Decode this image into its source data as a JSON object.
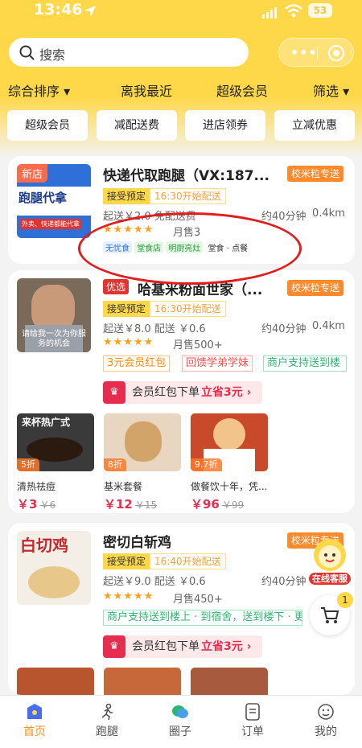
{
  "status_bar": {
    "time": "13:46",
    "battery": "53"
  },
  "search": {
    "placeholder": "搜索"
  },
  "sort_bar": {
    "items": [
      "综合排序 ▾",
      "离我最近",
      "超级会员",
      "筛选 ▾"
    ]
  },
  "filter_chips": [
    "超级会员",
    "减配送费",
    "进店领券",
    "立减优惠"
  ],
  "shops": [
    {
      "badge": "新店",
      "name": "快递代取跑腿（VX:187...",
      "delivery_tag": "校米粒专送",
      "preorder": "接受预定",
      "preorder_time": "16:30开始配送",
      "min_order": "起送￥2.0  免配送费",
      "eta": "约40分钟",
      "distance": "0.4km",
      "stars": "★★★★★",
      "sales": "月售3",
      "thumb_text": "跑腿代拿",
      "thumb_sub": "外卖、快递都能代拿",
      "platforms": [
        "无忧食",
        "堂食店",
        "明厨亮灶",
        "堂食 · 点餐"
      ]
    },
    {
      "badge": "优选",
      "name": "哈基米粉面世家（...",
      "delivery_tag": "校米粒专送",
      "preorder": "接受预定",
      "preorder_time": "16:30开始配送",
      "min_order": "起送￥8.0  配送 ￥0.6",
      "eta": "约40分钟",
      "distance": "0.4km",
      "stars": "★★★★★",
      "sales": "月售500+",
      "thumb_text": "请给我一次为你服务的机会",
      "coupons": [
        "3元会员红包",
        "回馈学弟学妹",
        "商户支持送到楼"
      ],
      "redpack": {
        "label": "会员红包下单",
        "action": "立省3元 ›"
      },
      "dishes": [
        {
          "discount": "5折",
          "name": "清热祛痘",
          "price": "￥3",
          "orig": "￥6",
          "img_text": "来杯热广式"
        },
        {
          "discount": "8折",
          "name": "基米套餐",
          "price": "￥12",
          "orig": "￥15",
          "img_text": ""
        },
        {
          "discount": "9.7折",
          "name": "做餐饮十年，凭...",
          "price": "￥96",
          "orig": "￥99",
          "img_text": ""
        }
      ]
    },
    {
      "name": "密切白斩鸡",
      "delivery_tag": "校米粒专送",
      "preorder": "接受预定",
      "preorder_time": "16:40开始配送",
      "min_order": "起送￥9.0  配送 ￥0.6",
      "eta": "约40分钟",
      "distance": "0.4km",
      "stars": "★★★★★",
      "sales": "月售450+",
      "thumb_text": "白切鸡",
      "coupons": [
        "商户支持送到楼上 · 到宿舍，送到楼下 · 更"
      ],
      "redpack": {
        "label": "会员红包下单",
        "action": "立省3元 ›"
      }
    }
  ],
  "float": {
    "service": "在线客服",
    "cart_count": "1"
  },
  "tabbar": [
    "首页",
    "跑腿",
    "圈子",
    "订单",
    "我的"
  ],
  "colors": {
    "brand_yellow": "#ffd84a",
    "accent_orange": "#f7941d",
    "price_red": "#e72d4f",
    "annotation_red": "#e21b1b"
  }
}
